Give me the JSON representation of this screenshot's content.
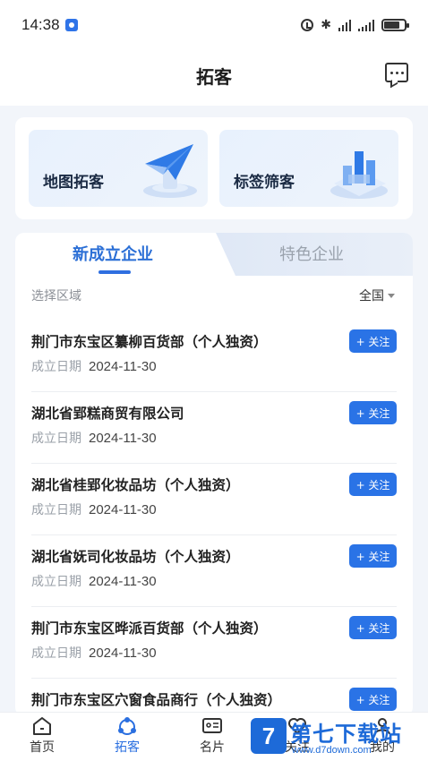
{
  "status_bar": {
    "time": "14:38"
  },
  "header": {
    "title": "拓客",
    "message_icon": "message-icon"
  },
  "tools": [
    {
      "label": "地图拓客",
      "icon": "paper-plane-illustration"
    },
    {
      "label": "标签筛客",
      "icon": "bar-chart-illustration"
    }
  ],
  "tabs": {
    "active": "新成立企业",
    "inactive": "特色企业"
  },
  "region": {
    "label": "选择区域",
    "value": "全国"
  },
  "date_label": "成立日期",
  "follow_label": "+ 关注",
  "companies": [
    {
      "name": "荆门市东宝区纂柳百货部（个人独资）",
      "date": "2024-11-30"
    },
    {
      "name": "湖北省郢糕商贸有限公司",
      "date": "2024-11-30"
    },
    {
      "name": "湖北省桂郢化妆品坊（个人独资）",
      "date": "2024-11-30"
    },
    {
      "name": "湖北省妩司化妆品坊（个人独资）",
      "date": "2024-11-30"
    },
    {
      "name": "荆门市东宝区晔派百货部（个人独资）",
      "date": "2024-11-30"
    },
    {
      "name": "荆门市东宝区穴窗食品商行（个人独资）",
      "date": ""
    }
  ],
  "bottom_nav": [
    {
      "label": "首页",
      "icon": "home-icon"
    },
    {
      "label": "拓客",
      "icon": "prospect-icon"
    },
    {
      "label": "名片",
      "icon": "card-icon"
    },
    {
      "label": "关注",
      "icon": "heart-icon"
    },
    {
      "label": "我的",
      "icon": "user-icon"
    }
  ],
  "watermark": {
    "logo": "7",
    "text": "第七下载站",
    "url": "www.d7down.com"
  },
  "colors": {
    "accent": "#2a73e6",
    "background": "#f2f5fa"
  }
}
